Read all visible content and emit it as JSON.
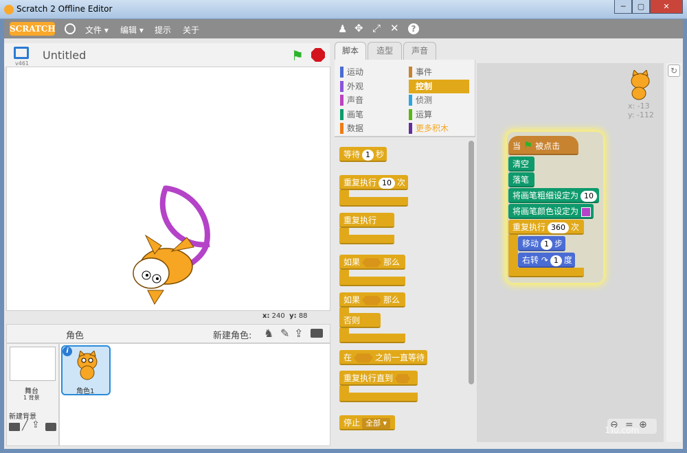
{
  "window": {
    "title": "Scratch 2 Offline Editor"
  },
  "menu": {
    "logo": "SCRATCH",
    "file": "文件 ▾",
    "edit": "编辑 ▾",
    "tips": "提示",
    "about": "关于"
  },
  "stage": {
    "title": "Untitled",
    "version": "v461",
    "x_label": "x:",
    "x_value": "240",
    "y_label": "y:",
    "y_value": "88"
  },
  "sprites": {
    "header": "角色",
    "new_sprite_label": "新建角色:",
    "sprite_name": "角色1",
    "stage_label": "舞台",
    "stage_backdrops": "1 背景",
    "new_backdrop": "新建背景"
  },
  "tabs": [
    "脚本",
    "造型",
    "声音"
  ],
  "categories": [
    {
      "label": "运动",
      "color": "#4a6cd4"
    },
    {
      "label": "事件",
      "color": "#c88330"
    },
    {
      "label": "外观",
      "color": "#8a55d7"
    },
    {
      "label": "控制",
      "color": "#e1a91a"
    },
    {
      "label": "声音",
      "color": "#bb42c3"
    },
    {
      "label": "侦测",
      "color": "#2ca5e2"
    },
    {
      "label": "画笔",
      "color": "#0e9a6c"
    },
    {
      "label": "运算",
      "color": "#5cb712"
    },
    {
      "label": "数据",
      "color": "#ee7d16"
    },
    {
      "label": "更多积木",
      "color": "#632d99"
    }
  ],
  "palette": {
    "wait": "等待",
    "wait_val": "1",
    "wait_unit": "秒",
    "repeat": "重复执行",
    "repeat_val": "10",
    "repeat_unit": "次",
    "forever": "重复执行",
    "if": "如果",
    "then": "那么",
    "if2": "如果",
    "then2": "那么",
    "else": "否则",
    "waituntil_pre": "在",
    "waituntil_post": "之前一直等待",
    "repeatuntil": "重复执行直到",
    "stop": "停止",
    "stop_val": "全部 ▾"
  },
  "script": {
    "hat_pre": "当",
    "hat_post": "被点击",
    "clear": "清空",
    "pendown": "落笔",
    "pensize": "将画笔粗细设定为",
    "pensize_val": "10",
    "pencolor": "将画笔颜色设定为",
    "repeat": "重复执行",
    "repeat_val": "360",
    "repeat_unit": "次",
    "move": "移动",
    "move_val": "1",
    "move_unit": "步",
    "turn": "右转",
    "turn_val": "1",
    "turn_unit": "度",
    "sprite_x": "x: -13",
    "sprite_y": "y: -112"
  },
  "watermark": "1Tu.com"
}
